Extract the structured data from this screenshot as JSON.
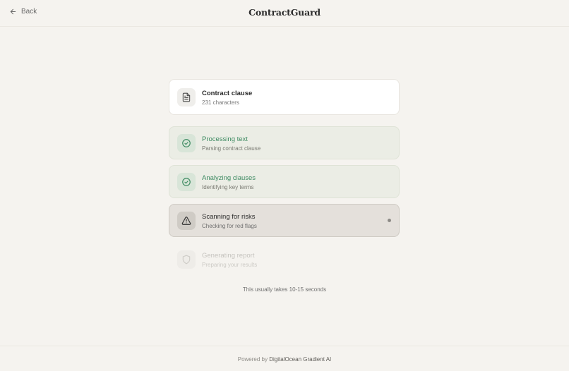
{
  "header": {
    "back_label": "Back",
    "brand": "ContractGuard"
  },
  "clause_card": {
    "title": "Contract clause",
    "subtitle": "231 characters",
    "icon": "document-icon"
  },
  "steps": [
    {
      "title": "Processing text",
      "subtitle": "Parsing contract clause",
      "status": "complete",
      "icon": "check-circle-icon"
    },
    {
      "title": "Analyzing clauses",
      "subtitle": "Identifying key terms",
      "status": "complete",
      "icon": "check-circle-icon"
    },
    {
      "title": "Scanning for risks",
      "subtitle": "Checking for red flags",
      "status": "in-progress",
      "icon": "warning-triangle-icon"
    },
    {
      "title": "Generating report",
      "subtitle": "Preparing your results",
      "status": "pending",
      "icon": "shield-icon"
    }
  ],
  "note": "This usually takes 10-15 seconds",
  "footer": {
    "prefix": "Powered by",
    "provider": "DigitalOcean Gradient AI"
  },
  "colors": {
    "background": "#f5f3ef",
    "success_green": "#3d8a61",
    "active_bg": "#e4e0db"
  }
}
